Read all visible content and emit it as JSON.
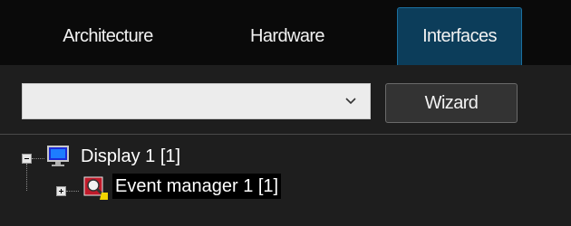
{
  "tabs": [
    {
      "label": "Architecture",
      "active": false
    },
    {
      "label": "Hardware",
      "active": false
    },
    {
      "label": "Interfaces",
      "active": true
    }
  ],
  "toolbar": {
    "combo_value": "",
    "wizard_label": "Wizard"
  },
  "tree": {
    "root": {
      "label": "Display 1 [1]",
      "icon": "monitor-icon",
      "expanded": true
    },
    "child": {
      "label": "Event manager 1 [1]",
      "icon": "event-manager-icon",
      "expanded": false,
      "selected": true
    }
  },
  "colors": {
    "active_tab": "#0c3d5a",
    "background": "#1e1e1e",
    "tabbar": "#0a0a0a"
  }
}
